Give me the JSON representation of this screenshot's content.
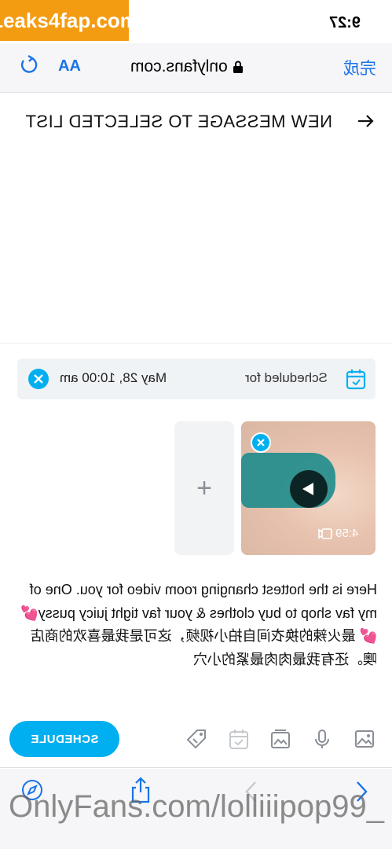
{
  "watermark": "Leaks4fap.com",
  "status_bar": {
    "time": "9:27"
  },
  "browser": {
    "aa_label": "AA",
    "url": "onlyfans.com",
    "done_label": "完成",
    "bottom_url": "OnlyFans.com/lolliiipop99_"
  },
  "header": {
    "title": "NEW MESSAGE TO SELECTED LIST"
  },
  "schedule": {
    "label": "Scheduled for",
    "date": "May 28, 10:00 am"
  },
  "media": {
    "add_label": "+",
    "video_duration": "4:59"
  },
  "message": {
    "text": "Here is the hottest changing room video for you. One of my fav shop to buy clothes & your fav tight juicy pussy💕💕 最火辣的换衣间自拍小视频，这可是我最喜欢的商店噢。还有我最肉肉最紧的小穴"
  },
  "toolbar": {
    "schedule_label": "SCHEDULE"
  },
  "colors": {
    "accent": "#00aff0",
    "ios_blue": "#1a73e8"
  },
  "icons": [
    "refresh-icon",
    "lock-icon",
    "arrow-icon",
    "clear-icon",
    "calendar-icon",
    "plus-icon",
    "remove-icon",
    "play-icon",
    "video-camera-icon",
    "image-icon",
    "microphone-icon",
    "gallery-icon",
    "calendar-check-icon",
    "price-tag-icon",
    "compass-icon",
    "share-icon",
    "back-icon",
    "forward-icon"
  ]
}
